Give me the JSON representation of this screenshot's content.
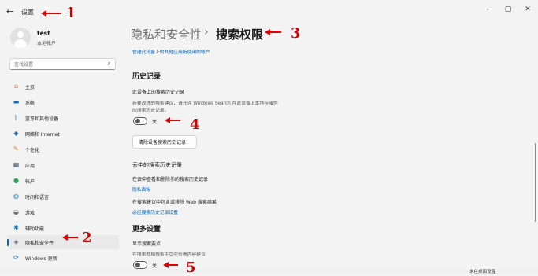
{
  "window": {
    "title": "设置",
    "min": "–",
    "max": "▢",
    "close": "✕"
  },
  "user": {
    "name": "test",
    "account_type": "本地帐户"
  },
  "search": {
    "placeholder": "查找设置"
  },
  "sidebar": {
    "items": [
      {
        "label": "主页",
        "icon": "home-icon",
        "glyph": "⌂",
        "color": "#e06c1f"
      },
      {
        "label": "系统",
        "icon": "display-icon",
        "glyph": "▬",
        "color": "#0067c0"
      },
      {
        "label": "蓝牙和其他设备",
        "icon": "bluetooth-icon",
        "glyph": "ᛒ",
        "color": "#0067c0"
      },
      {
        "label": "网络和 Internet",
        "icon": "wifi-icon",
        "glyph": "◆",
        "color": "#2b6ea8"
      },
      {
        "label": "个性化",
        "icon": "brush-icon",
        "glyph": "✎",
        "color": "#c8862a"
      },
      {
        "label": "应用",
        "icon": "apps-icon",
        "glyph": "▦",
        "color": "#3a4f66"
      },
      {
        "label": "帐户",
        "icon": "person-icon",
        "glyph": "●",
        "color": "#2aa05a"
      },
      {
        "label": "时间和语言",
        "icon": "globe-clock-icon",
        "glyph": "◍",
        "color": "#1e88c9"
      },
      {
        "label": "游戏",
        "icon": "gamepad-icon",
        "glyph": "◒",
        "color": "#6c6c6c"
      },
      {
        "label": "辅助功能",
        "icon": "accessibility-icon",
        "glyph": "✱",
        "color": "#1f6fb2"
      },
      {
        "label": "隐私和安全性",
        "icon": "shield-icon",
        "glyph": "◈",
        "color": "#6b7480",
        "selected": true
      },
      {
        "label": "Windows 更新",
        "icon": "update-icon",
        "glyph": "⟳",
        "color": "#0067c0"
      }
    ]
  },
  "breadcrumb": {
    "parent": "隐私和安全性",
    "separator": "›",
    "current": "搜索权限"
  },
  "manage_link": "管理此设备上的其他应用所使用的帐户",
  "history": {
    "heading": "历史记录",
    "device_title": "此设备上的搜索历史记录",
    "device_desc_1": "若要改进的搜索建议，请允许 Windows Search 在此设备上本地存储你",
    "device_desc_2": "的搜索历史记录。",
    "toggle_label": "关",
    "clear_button": "清除设备搜索历史记录"
  },
  "cloud": {
    "title": "云中的搜索历史记录",
    "view_text": "在云中查看和删除你的搜索历史记录",
    "privacy_link": "隐私面板",
    "include_text": "在搜索建议中包含或排除 Web 搜索结果",
    "settings_link": "必应搜索历史记录设置"
  },
  "more": {
    "heading": "更多设置",
    "highlights_title": "显示搜索要点",
    "highlights_desc": "在搜索框和搜索主页中查看内容建议",
    "toggle_label": "关"
  },
  "bottom_button": "未在桌面设置",
  "annotations": [
    "1",
    "2",
    "3",
    "4",
    "5"
  ]
}
